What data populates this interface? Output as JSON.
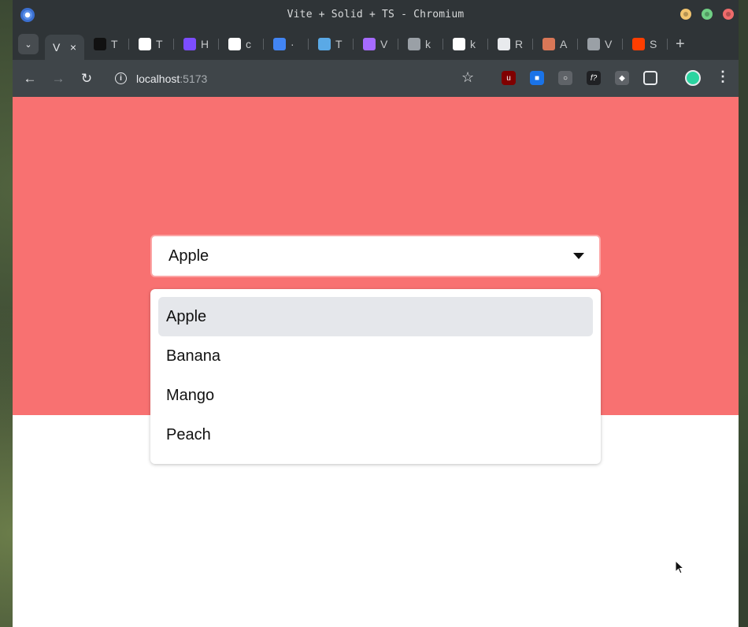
{
  "window": {
    "title": "Vite + Solid + TS - Chromium"
  },
  "tabs": {
    "active": {
      "label": "V",
      "close": "×"
    },
    "items": [
      {
        "label": "T",
        "icon": "slash-logo-icon",
        "color": "#111111"
      },
      {
        "label": "T",
        "icon": "white-circle-icon",
        "color": "#ffffff"
      },
      {
        "label": "H",
        "icon": "rocket-icon",
        "color": "#7c4dff"
      },
      {
        "label": "c",
        "icon": "google-icon",
        "color": "#ffffff"
      },
      {
        "label": "·",
        "icon": "chrome-badge-icon",
        "color": "#4285f4"
      },
      {
        "label": "T",
        "icon": "feather-icon",
        "color": "#5aa9e6"
      },
      {
        "label": "V",
        "icon": "vite-icon",
        "color": "#a66bff"
      },
      {
        "label": "k",
        "icon": "avatar-icon",
        "color": "#9aa0a6"
      },
      {
        "label": "k",
        "icon": "github-icon",
        "color": "#ffffff"
      },
      {
        "label": "R",
        "icon": "openai-icon",
        "color": "#e8eaed"
      },
      {
        "label": "A",
        "icon": "anthropic-icon",
        "color": "#d97757"
      },
      {
        "label": "V",
        "icon": "globe-icon",
        "color": "#9aa0a6"
      },
      {
        "label": "S",
        "icon": "svelte-icon",
        "color": "#ff3e00"
      }
    ],
    "new_tab": "+"
  },
  "toolbar": {
    "url_host": "localhost",
    "url_port": ":5173"
  },
  "select": {
    "value": "Apple",
    "options": [
      "Apple",
      "Banana",
      "Mango",
      "Peach"
    ],
    "highlighted_index": 0
  },
  "colors": {
    "hero": "#f87171",
    "trigger_border": "#fca5a5",
    "option_highlight": "#e5e7eb"
  }
}
